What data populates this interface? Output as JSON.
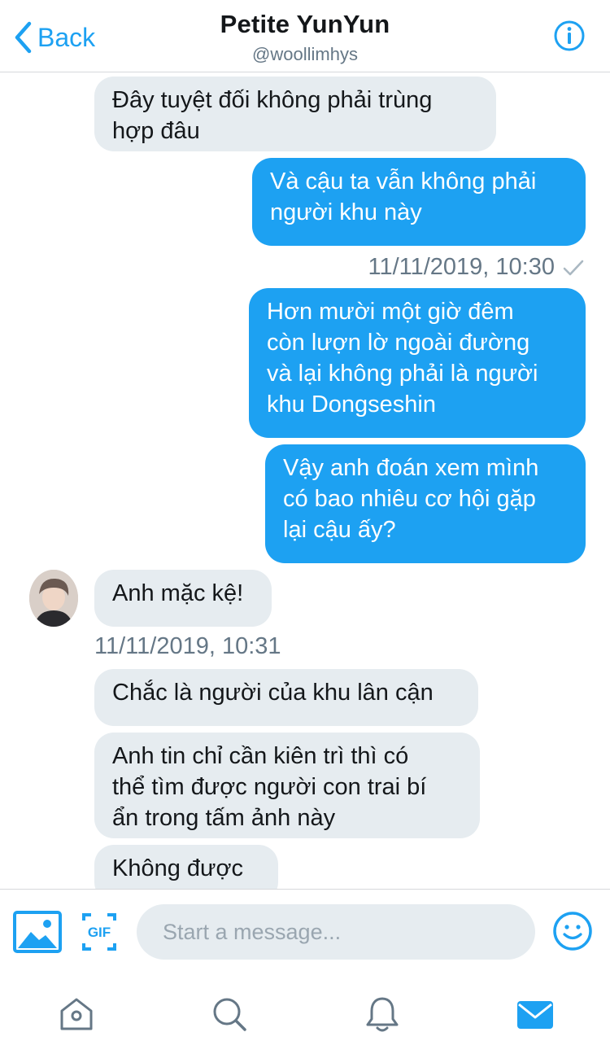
{
  "header": {
    "back_label": "Back",
    "title": "Petite YunYun",
    "handle": "@woollimhys"
  },
  "messages": [
    {
      "side": "in",
      "text": "Đây tuyệt đối không phải trùng\nhợp đâu"
    },
    {
      "side": "out",
      "text": "Và cậu ta vẫn không phải\nngười khu này"
    },
    {
      "side": "out",
      "text": "Hơn mười một giờ đêm\ncòn lượn lờ ngoài đường\nvà lại không phải là người\nkhu Dongseshin"
    },
    {
      "side": "out",
      "text": "Vậy anh đoán xem mình\ncó bao nhiêu cơ hội gặp\nlại cậu ấy?"
    },
    {
      "side": "in",
      "text": "Anh mặc kệ!"
    },
    {
      "side": "in",
      "text": "Chắc là người của khu lân cận"
    },
    {
      "side": "in",
      "text": "Anh tin chỉ cần kiên trì thì có\nthể tìm được người con trai bí\nẩn trong tấm ảnh này"
    },
    {
      "side": "in",
      "text": "Không được"
    }
  ],
  "timestamps": {
    "out_1": "11/11/2019, 10:30",
    "in_1": "11/11/2019, 10:31"
  },
  "composer": {
    "placeholder": "Start a message..."
  },
  "icons": {
    "back": "chevron-left-icon",
    "info": "info-icon",
    "read_receipt": "checkmark-icon",
    "photo": "image-icon",
    "gif": "gif-icon",
    "emoji": "smiley-icon",
    "home": "home-icon",
    "search": "search-icon",
    "notifications": "bell-icon",
    "messages": "mail-icon"
  },
  "colors": {
    "accent": "#1da1f2",
    "incoming_bubble": "#e6ecf0",
    "secondary_text": "#657786"
  }
}
